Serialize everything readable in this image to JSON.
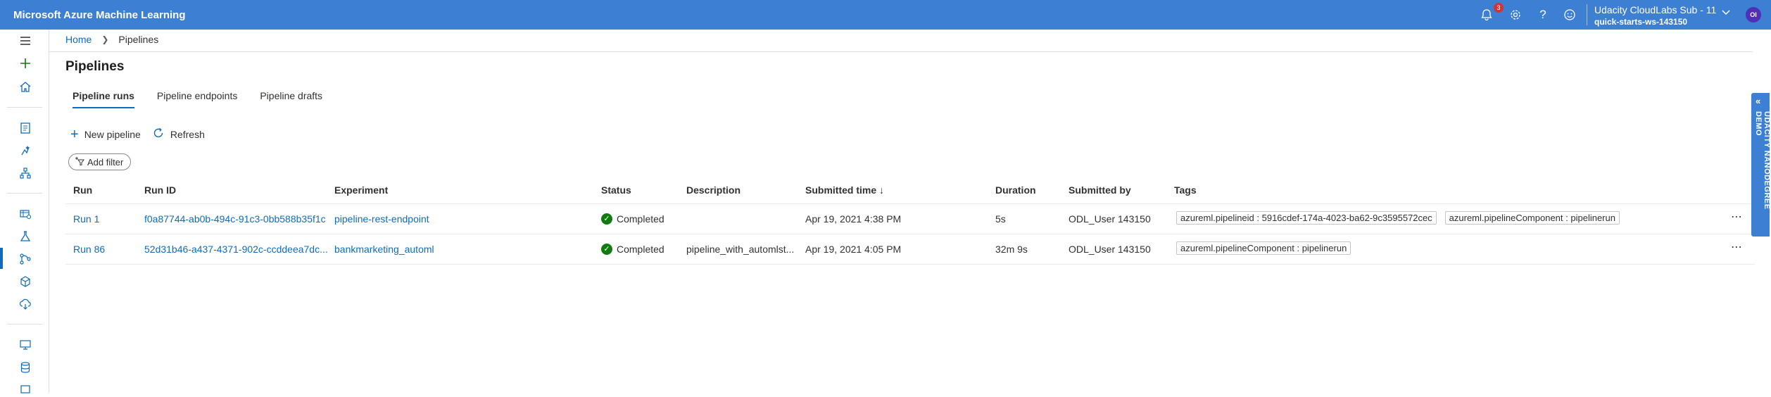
{
  "app": {
    "title": "Microsoft Azure Machine Learning"
  },
  "topbar": {
    "notifications_count": "3",
    "account_name": "Udacity CloudLabs Sub - 11",
    "workspace": "quick-starts-ws-143150",
    "avatar_initials": "OI"
  },
  "breadcrumb": {
    "home": "Home",
    "current": "Pipelines"
  },
  "page": {
    "title": "Pipelines"
  },
  "tabs": [
    {
      "label": "Pipeline runs"
    },
    {
      "label": "Pipeline endpoints"
    },
    {
      "label": "Pipeline drafts"
    }
  ],
  "toolbar": {
    "new_pipeline": "New pipeline",
    "refresh": "Refresh"
  },
  "filter": {
    "label": "Add filter"
  },
  "table": {
    "headers": {
      "run": "Run",
      "run_id": "Run ID",
      "experiment": "Experiment",
      "status": "Status",
      "description": "Description",
      "submitted_time": "Submitted time ↓",
      "duration": "Duration",
      "submitted_by": "Submitted by",
      "tags": "Tags"
    },
    "rows": [
      {
        "run": "Run 1",
        "run_id": "f0a87744-ab0b-494c-91c3-0bb588b35f1c",
        "experiment": "pipeline-rest-endpoint",
        "status": "Completed",
        "description": "",
        "submitted_time": "Apr 19, 2021 4:38 PM",
        "duration": "5s",
        "submitted_by": "ODL_User 143150",
        "tags": [
          "azureml.pipelineid : 5916cdef-174a-4023-ba62-9c3595572cec",
          "azureml.pipelineComponent : pipelinerun"
        ]
      },
      {
        "run": "Run 86",
        "run_id": "52d31b46-a437-4371-902c-ccddeea7dc...",
        "experiment": "bankmarketing_automl",
        "status": "Completed",
        "description": "pipeline_with_automlst...",
        "submitted_time": "Apr 19, 2021 4:05 PM",
        "duration": "32m 9s",
        "submitted_by": "ODL_User 143150",
        "tags": [
          "azureml.pipelineComponent : pipelinerun"
        ]
      }
    ]
  },
  "side_panel": {
    "label": "UDACITY NANODEGREE DEMO"
  },
  "colors": {
    "topbar": "#3c7fd3",
    "accent": "#0f6cbd",
    "success": "#107c10",
    "badge": "#d13438"
  }
}
